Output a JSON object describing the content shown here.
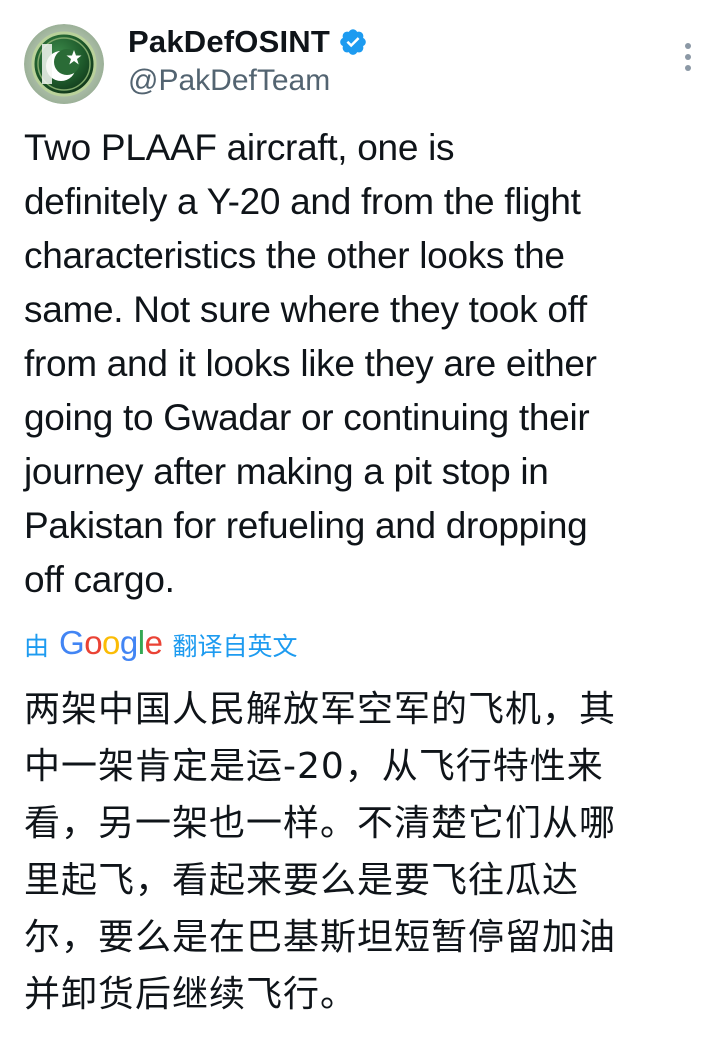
{
  "author": {
    "display_name": "PakDefOSINT",
    "handle": "@PakDefTeam",
    "verified": true,
    "avatar_icon": "pakistan-flag-emblem"
  },
  "tweet": {
    "text": "Two PLAAF aircraft, one is\ndefinitely a Y-20 and from the flight\ncharacteristics the other looks the\nsame. Not sure where they took off\nfrom and it looks like they are either\ngoing to Gwadar or continuing their\njourney after making a pit stop in\nPakistan for refueling and dropping\noff cargo."
  },
  "translation": {
    "prefix": "由",
    "provider": "Google",
    "suffix": "翻译自英文",
    "text": "两架中国人民解放军空军的飞机，其\n中一架肯定是运-20，从飞行特性来\n看，另一架也一样。不清楚它们从哪\n里起飞，看起来要么是要飞往瓜达\n尔，要么是在巴基斯坦短暂停留加油\n并卸货后继续飞行。"
  },
  "colors": {
    "text": "#0f1419",
    "secondary": "#536471",
    "link": "#1d9bf0",
    "verified": "#1d9bf0",
    "google_blue": "#4285f4",
    "google_red": "#ea4335",
    "google_yellow": "#fbbc05",
    "google_green": "#34a853"
  }
}
